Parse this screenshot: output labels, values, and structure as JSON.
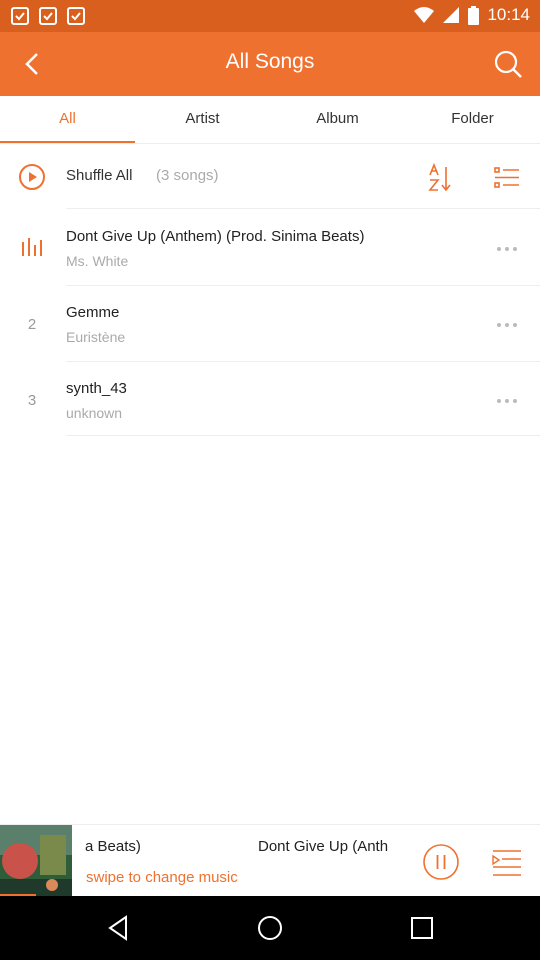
{
  "status_bar": {
    "time": "10:14",
    "icons": [
      "notification-icon",
      "notification-icon",
      "notification-icon",
      "wifi-icon",
      "cell-signal-icon",
      "battery-icon"
    ]
  },
  "app_bar": {
    "title": "All Songs",
    "back_icon": "chevron-left-icon",
    "search_icon": "search-icon"
  },
  "tabs": [
    {
      "label": "All",
      "active": true
    },
    {
      "label": "Artist",
      "active": false
    },
    {
      "label": "Album",
      "active": false
    },
    {
      "label": "Folder",
      "active": false
    }
  ],
  "shuffle": {
    "label": "Shuffle All",
    "count": "(3 songs)"
  },
  "songs": [
    {
      "index": "",
      "title": "Dont Give Up (Anthem) (Prod. Sinima Beats)",
      "artist": "Ms. White",
      "playing": true
    },
    {
      "index": "2",
      "title": "Gemme",
      "artist": "Euristène",
      "playing": false
    },
    {
      "index": "3",
      "title": "synth_43",
      "artist": "unknown",
      "playing": false
    }
  ],
  "player": {
    "marquee_tail": "a Beats)",
    "marquee_head": "Dont Give Up (Anth",
    "hint": "swipe to change music"
  },
  "colors": {
    "accent": "#ee7130",
    "status_bar": "#d95f1f"
  }
}
